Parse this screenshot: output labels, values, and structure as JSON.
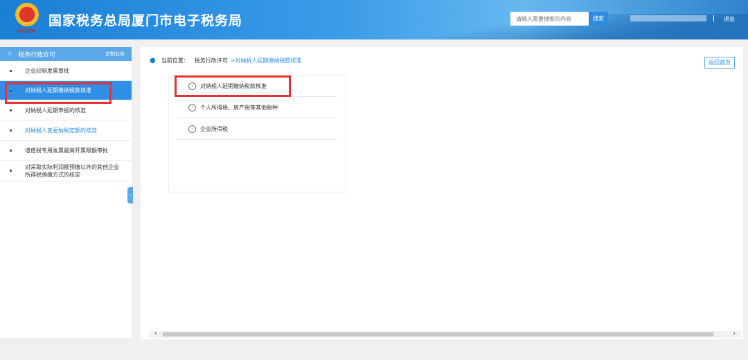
{
  "header": {
    "title": "国家税务总局厦门市电子税务局",
    "emblem_caption": "中国税务",
    "search_placeholder": "请输入需要搜索的内容",
    "search_label": "搜索",
    "logout_label": "退出"
  },
  "sidebar": {
    "title": "税务行政许可",
    "customize_label": "定制业务",
    "items": [
      {
        "label": "企业印制发票审批"
      },
      {
        "label": "对纳税人延期缴纳税款核准",
        "active": true
      },
      {
        "label": "对纳税人延期申报的核准"
      },
      {
        "label": "对纳税人变更纳税定额的核准"
      },
      {
        "label": "增值税专用发票最高开票限额审批"
      },
      {
        "label": "对采取实际利润额预缴以外的其他企业所得税预缴方式的核定"
      }
    ]
  },
  "main": {
    "breadcrumb_label": "当前位置：",
    "breadcrumb_root": "税务行政许可",
    "breadcrumb_current": ">对纳税人延期缴纳税款核准",
    "back_label": "返回首页",
    "options": [
      {
        "label": "对纳税人延期缴纳税款核准"
      },
      {
        "label": "个人所得税、房产税等其他税种"
      },
      {
        "label": "企业所得税"
      }
    ]
  },
  "colors": {
    "accent": "#2f8ee6",
    "highlight": "#e53333"
  }
}
